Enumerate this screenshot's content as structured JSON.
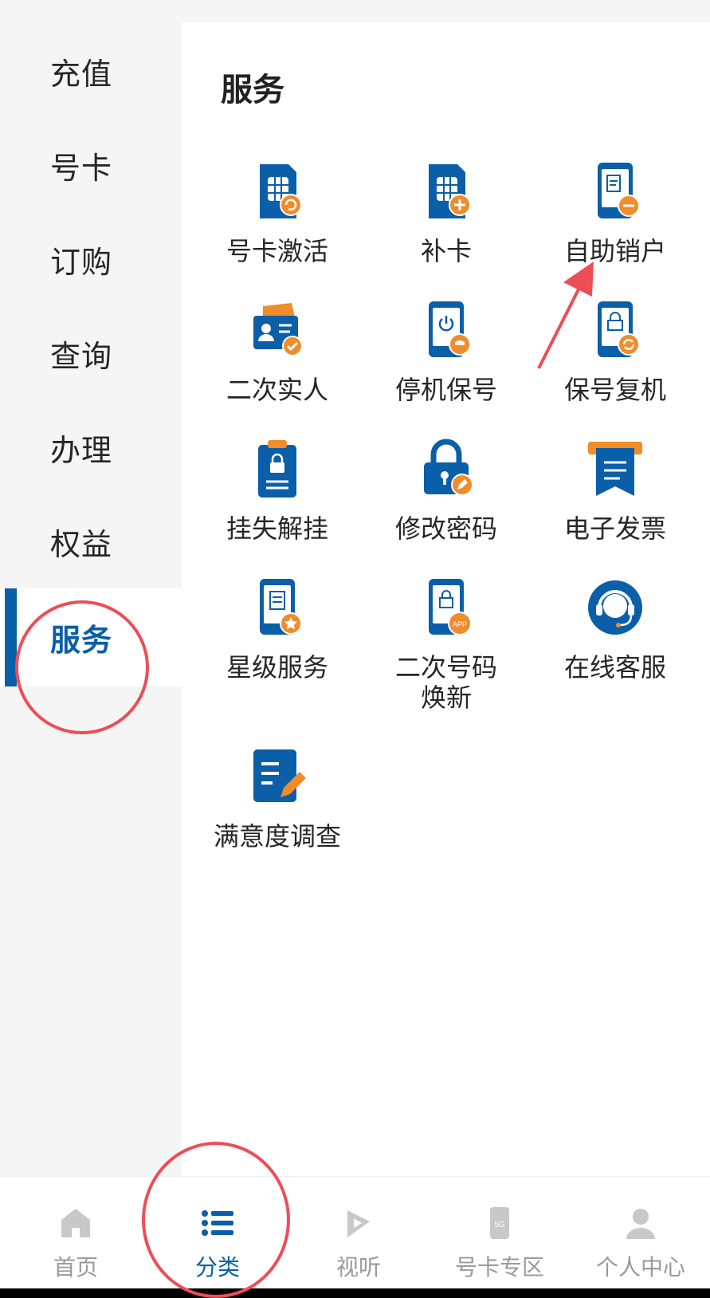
{
  "sidebar": {
    "items": [
      {
        "label": "充值"
      },
      {
        "label": "号卡"
      },
      {
        "label": "订购"
      },
      {
        "label": "查询"
      },
      {
        "label": "办理"
      },
      {
        "label": "权益"
      },
      {
        "label": "服务",
        "active": true
      }
    ]
  },
  "main": {
    "title": "服务",
    "services": [
      {
        "label": "号卡激活",
        "icon": "sim-card-refresh-icon"
      },
      {
        "label": "补卡",
        "icon": "sim-card-add-icon"
      },
      {
        "label": "自助销户",
        "icon": "phone-cancel-icon"
      },
      {
        "label": "二次实人",
        "icon": "id-card-check-icon"
      },
      {
        "label": "停机保号",
        "icon": "phone-power-icon"
      },
      {
        "label": "保号复机",
        "icon": "phone-lock-refresh-icon"
      },
      {
        "label": "挂失解挂",
        "icon": "clipboard-lock-icon"
      },
      {
        "label": "修改密码",
        "icon": "padlock-edit-icon"
      },
      {
        "label": "电子发票",
        "icon": "invoice-icon"
      },
      {
        "label": "星级服务",
        "icon": "phone-star-icon"
      },
      {
        "label": "二次号码\n焕新",
        "line1": "二次号码",
        "line2": "焕新",
        "icon": "phone-app-lock-icon"
      },
      {
        "label": "在线客服",
        "icon": "headset-agent-icon"
      },
      {
        "label": "满意度调查",
        "icon": "survey-edit-icon"
      }
    ]
  },
  "tabbar": {
    "tabs": [
      {
        "label": "首页",
        "icon": "home-icon"
      },
      {
        "label": "分类",
        "icon": "list-icon",
        "active": true
      },
      {
        "label": "视听",
        "icon": "media-icon"
      },
      {
        "label": "号卡专区",
        "icon": "5g-phone-icon"
      },
      {
        "label": "个人中心",
        "icon": "person-icon"
      }
    ]
  },
  "colors": {
    "primary": "#0b5ea8",
    "accent_orange": "#f08c2a",
    "annotation_red": "#ec4e57"
  }
}
